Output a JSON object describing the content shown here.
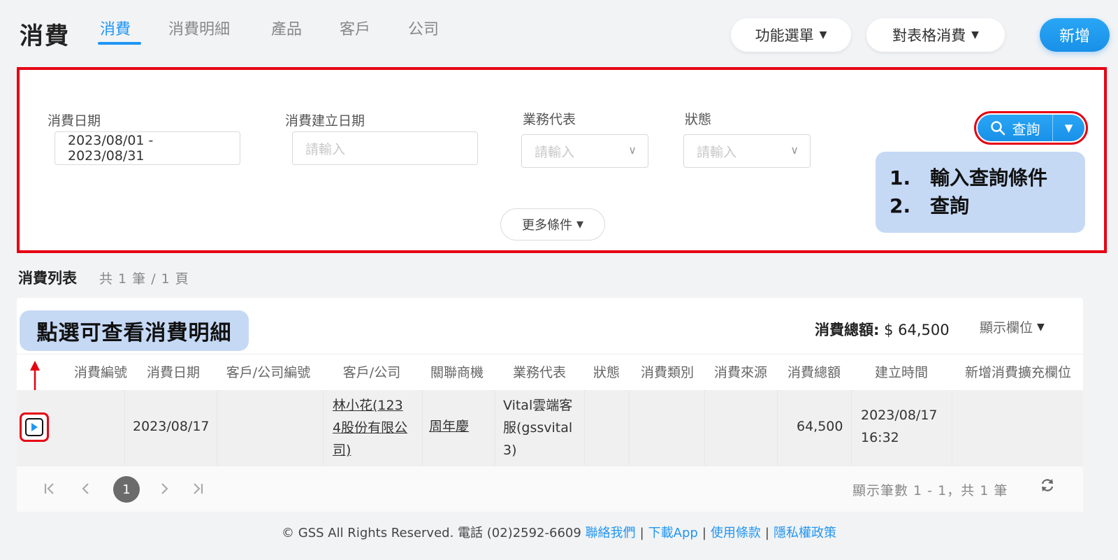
{
  "header": {
    "title": "消費",
    "tabs": [
      {
        "label": "消費",
        "active": true
      },
      {
        "label": "消費明細"
      },
      {
        "label": "產品"
      },
      {
        "label": "客戶"
      },
      {
        "label": "公司"
      }
    ],
    "function_menu": "功能選單",
    "table_action": "對表格消費",
    "add": "新增"
  },
  "filters": {
    "date_label": "消費日期",
    "date_value": "2023/08/01 - 2023/08/31",
    "created_label": "消費建立日期",
    "created_placeholder": "請輸入",
    "sales_label": "業務代表",
    "sales_placeholder": "請輸入",
    "status_label": "狀態",
    "status_placeholder": "請輸入",
    "query": "查詢",
    "more": "更多條件"
  },
  "annotations": {
    "steps": [
      {
        "num": "1.",
        "text": "輸入查詢條件"
      },
      {
        "num": "2.",
        "text": "查詢"
      }
    ],
    "view_hint": "點選可查看消費明細"
  },
  "list": {
    "title": "消費列表",
    "count": "共 1 筆 / 1 頁",
    "total_label": "消費總額:",
    "total_value": "$ 64,500",
    "columns_button": "顯示欄位",
    "columns": [
      "消費編號",
      "消費日期",
      "客戶/公司編號",
      "客戶/公司",
      "關聯商機",
      "業務代表",
      "狀態",
      "消費類別",
      "消費來源",
      "消費總額",
      "建立時間",
      "新增消費擴充欄位"
    ],
    "row": {
      "date": "2023/08/17",
      "customer_lines": [
        "林小花(123",
        "4股份有限公",
        "司)"
      ],
      "opportunity": "周年慶",
      "sales_lines": [
        "Vital雲端客",
        "服(gssvital",
        "3)"
      ],
      "total": "64,500",
      "created_lines": [
        "2023/08/17",
        "16:32"
      ]
    }
  },
  "pagination": {
    "current": "1",
    "info": "顯示筆數 1 - 1，共 1 筆"
  },
  "footer": {
    "copyright": "© GSS All Rights Reserved. 電話 (02)2592-6609",
    "links": [
      "聯絡我們",
      "下載App",
      "使用條款",
      "隱私權政策"
    ]
  },
  "colors": {
    "accent": "#2196f3",
    "annotation_red": "#e60012",
    "callout_bg": "#c5d9f5"
  }
}
